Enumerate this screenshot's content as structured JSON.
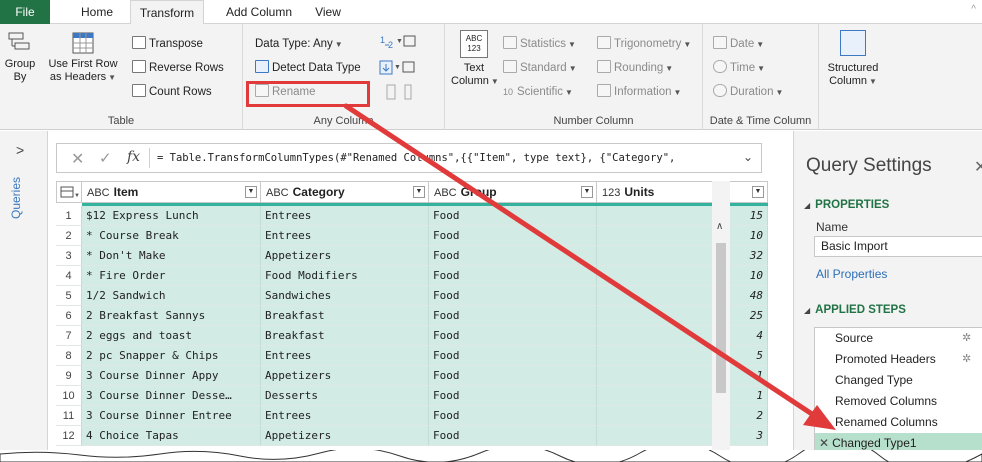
{
  "tabs": [
    "File",
    "Home",
    "Transform",
    "Add Column",
    "View"
  ],
  "ribbon": {
    "table": {
      "label": "Table",
      "group_by": [
        "Group",
        "By"
      ],
      "use_first_row": [
        "Use First Row",
        "as Headers"
      ],
      "transpose": "Transpose",
      "reverse_rows": "Reverse Rows",
      "count_rows": "Count Rows"
    },
    "any_column": {
      "label": "Any Column",
      "data_type": "Data Type: Any",
      "detect_data_type": "Detect Data Type",
      "rename": "Rename"
    },
    "text_column": [
      "Text",
      "Column"
    ],
    "number_column": {
      "label": "Number Column",
      "statistics": "Statistics",
      "standard": "Standard",
      "scientific": "Scientific",
      "trigonometry": "Trigonometry",
      "rounding": "Rounding",
      "information": "Information"
    },
    "date_time": {
      "label": "Date & Time Column",
      "date": "Date",
      "time": "Time",
      "duration": "Duration"
    },
    "structured_column": [
      "Structured",
      "Column"
    ],
    "icon_text": {
      "abc": "ABC",
      "n123": "123",
      "ten": "10"
    }
  },
  "queries_pane": {
    "label": "Queries"
  },
  "formula_bar": {
    "fx": "fx",
    "text": "= Table.TransformColumnTypes(#\"Renamed Columns\",{{\"Item\", type text}, {\"Category\","
  },
  "grid": {
    "columns": [
      {
        "type": "ABC",
        "name": "Item"
      },
      {
        "type": "ABC",
        "name": "Category"
      },
      {
        "type": "ABC",
        "name": "Group"
      },
      {
        "type": "123",
        "name": "Units"
      }
    ],
    "rows": [
      {
        "n": "1",
        "item": "$12 Express Lunch",
        "category": "Entrees",
        "group": "Food",
        "units": "15"
      },
      {
        "n": "2",
        "item": "* Course Break",
        "category": "Entrees",
        "group": "Food",
        "units": "10"
      },
      {
        "n": "3",
        "item": "* Don't Make",
        "category": "Appetizers",
        "group": "Food",
        "units": "32"
      },
      {
        "n": "4",
        "item": "* Fire Order",
        "category": "Food Modifiers",
        "group": "Food",
        "units": "10"
      },
      {
        "n": "5",
        "item": "1/2 Sandwich",
        "category": "Sandwiches",
        "group": "Food",
        "units": "48"
      },
      {
        "n": "6",
        "item": "2 Breakfast Sannys",
        "category": "Breakfast",
        "group": "Food",
        "units": "25"
      },
      {
        "n": "7",
        "item": "2 eggs and toast",
        "category": "Breakfast",
        "group": "Food",
        "units": "4"
      },
      {
        "n": "8",
        "item": "2 pc Snapper & Chips",
        "category": "Entrees",
        "group": "Food",
        "units": "5"
      },
      {
        "n": "9",
        "item": "3 Course Dinner Appy",
        "category": "Appetizers",
        "group": "Food",
        "units": "1"
      },
      {
        "n": "10",
        "item": "3 Course Dinner Desse…",
        "category": "Desserts",
        "group": "Food",
        "units": "1"
      },
      {
        "n": "11",
        "item": "3 Course Dinner Entree",
        "category": "Entrees",
        "group": "Food",
        "units": "2"
      },
      {
        "n": "12",
        "item": "4 Choice Tapas",
        "category": "Appetizers",
        "group": "Food",
        "units": "3"
      }
    ]
  },
  "query_settings": {
    "title": "Query Settings",
    "properties_header": "PROPERTIES",
    "name_label": "Name",
    "name_value": "Basic Import",
    "all_properties": "All Properties",
    "applied_steps_header": "APPLIED STEPS",
    "steps": [
      "Source",
      "Promoted Headers",
      "Changed Type",
      "Removed Columns",
      "Renamed Columns",
      "Changed Type1"
    ]
  },
  "colors": {
    "file_tab": "#217346",
    "quality_bar": "#33b39e",
    "selected_cells": "#d2ebe4",
    "annotation": "#e03a3a",
    "active_step": "#b6dfcc"
  }
}
